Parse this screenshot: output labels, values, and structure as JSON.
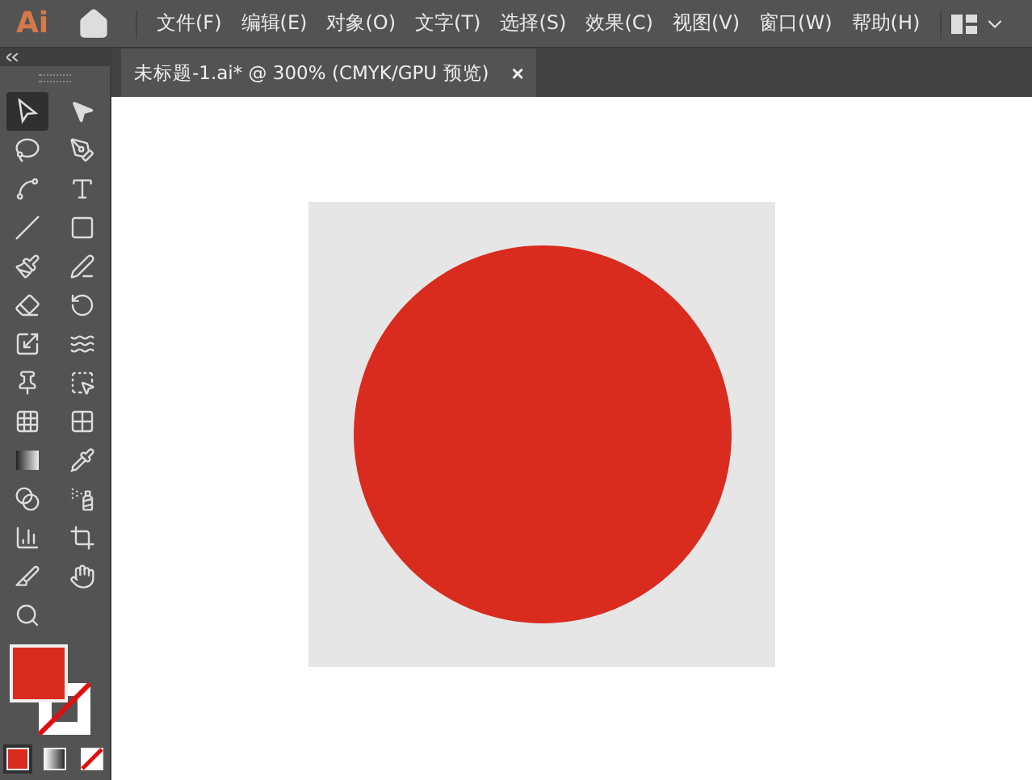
{
  "app": {
    "logo": "Ai"
  },
  "menu": [
    "文件(F)",
    "编辑(E)",
    "对象(O)",
    "文字(T)",
    "选择(S)",
    "效果(C)",
    "视图(V)",
    "窗口(W)",
    "帮助(H)"
  ],
  "document_tab": {
    "title": "未标题-1.ai* @ 300% (CMYK/GPU 预览)",
    "close": "×",
    "selected": true
  },
  "tools": [
    {
      "kind": "selection",
      "selected": true
    },
    {
      "kind": "direct",
      "selected": false
    },
    {
      "kind": "lasso",
      "selected": false
    },
    {
      "kind": "pen",
      "selected": false
    },
    {
      "kind": "curvature",
      "selected": false
    },
    {
      "kind": "type",
      "selected": false
    },
    {
      "kind": "line",
      "selected": false
    },
    {
      "kind": "rect",
      "selected": false
    },
    {
      "kind": "brush",
      "selected": false
    },
    {
      "kind": "shaper",
      "selected": false
    },
    {
      "kind": "eraser",
      "selected": false
    },
    {
      "kind": "rotate",
      "selected": false
    },
    {
      "kind": "scale",
      "selected": false
    },
    {
      "kind": "warp",
      "selected": false
    },
    {
      "kind": "pin",
      "selected": false
    },
    {
      "kind": "builder",
      "selected": false
    },
    {
      "kind": "perspective",
      "selected": false
    },
    {
      "kind": "mesh",
      "selected": false
    },
    {
      "kind": "gradient",
      "selected": false
    },
    {
      "kind": "eyedropper",
      "selected": false
    },
    {
      "kind": "blend",
      "selected": false
    },
    {
      "kind": "spray",
      "selected": false
    },
    {
      "kind": "graph",
      "selected": false
    },
    {
      "kind": "artboard",
      "selected": false
    },
    {
      "kind": "slice",
      "selected": false
    },
    {
      "kind": "hand",
      "selected": false
    },
    {
      "kind": "zoom",
      "selected": false
    }
  ],
  "color_modes": [
    {
      "kind": "color",
      "selected": true
    },
    {
      "kind": "gradient",
      "selected": false
    },
    {
      "kind": "none",
      "selected": false
    }
  ]
}
